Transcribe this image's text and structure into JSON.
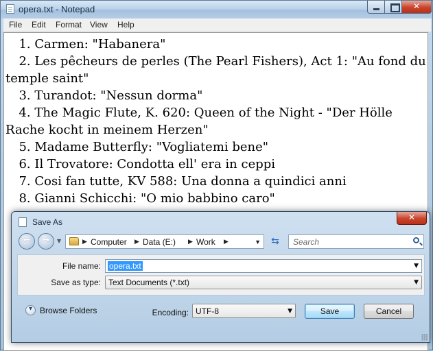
{
  "notepad": {
    "title": "opera.txt - Notepad",
    "menu": [
      "File",
      "Edit",
      "Format",
      "View",
      "Help"
    ],
    "lines": [
      " 1. Carmen: \"Habanera\"",
      " 2. Les pêcheurs de perles (The Pearl Fishers), Act 1: \"Au fond du",
      "temple saint\"",
      " 3. Turandot: \"Nessun dorma\"",
      " 4. The Magic Flute, K. 620: Queen of the Night - \"Der Hölle",
      "Rache kocht in meinem Herzen\"",
      " 5. Madame Butterfly: \"Vogliatemi bene\"",
      " 6. Il Trovatore: Condotta ell' era in ceppi",
      " 7. Cosi fan tutte, KV 588: Una donna a quindici anni",
      " 8. Gianni Schicchi: \"O mio babbino caro\""
    ]
  },
  "dialog": {
    "title": "Save As",
    "breadcrumb": [
      "Computer",
      "Data (E:)",
      "Work"
    ],
    "search_placeholder": "Search",
    "file_name_label": "File name:",
    "file_name_value": "opera.txt",
    "save_as_type_label": "Save as type:",
    "save_as_type_value": "Text Documents (*.txt)",
    "browse_folders_label": "Browse Folders",
    "encoding_label": "Encoding:",
    "encoding_value": "UTF-8",
    "save_label": "Save",
    "cancel_label": "Cancel"
  },
  "icons": {
    "back": "back-arrow-icon",
    "forward": "forward-arrow-icon",
    "folder": "folder-icon",
    "search": "search-icon",
    "refresh": "refresh-icon"
  },
  "colors": {
    "selection": "#3399ff",
    "close_button": "#c8432b",
    "save_button_border": "#3c7fb1"
  }
}
